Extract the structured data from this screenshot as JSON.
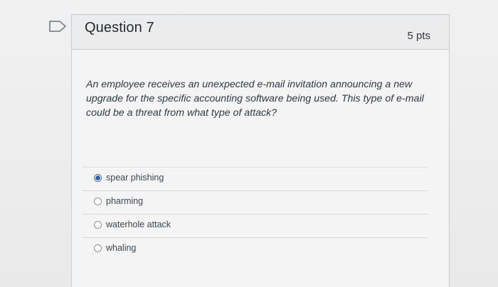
{
  "question": {
    "title": "Question 7",
    "points": "5 pts",
    "text": "An employee receives an unexpected e-mail invitation announcing a new upgrade for the specific accounting software being used. This type of e-mail could be a threat from what type of attack?",
    "answers": [
      {
        "label": "spear phishing",
        "selected": true
      },
      {
        "label": "pharming",
        "selected": false
      },
      {
        "label": "waterhole attack",
        "selected": false
      },
      {
        "label": "whaling",
        "selected": false
      }
    ]
  },
  "icons": {
    "flag": "flag-icon"
  },
  "colors": {
    "selected_radio": "#1f5fb8",
    "border": "#c7cdd1"
  }
}
